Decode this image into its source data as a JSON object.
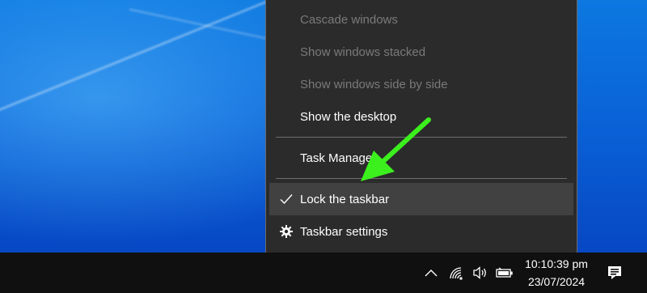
{
  "context_menu": {
    "items": [
      {
        "label": "Cascade windows",
        "enabled": false
      },
      {
        "label": "Show windows stacked",
        "enabled": false
      },
      {
        "label": "Show windows side by side",
        "enabled": false
      },
      {
        "label": "Show the desktop",
        "enabled": true
      },
      {
        "label": "Task Manager",
        "enabled": true
      },
      {
        "label": "Lock the taskbar",
        "enabled": true,
        "checked": true,
        "highlighted": true
      },
      {
        "label": "Taskbar settings",
        "enabled": true,
        "icon": "gear-icon"
      }
    ]
  },
  "taskbar": {
    "tray_icons": [
      "chevron-up-icon",
      "wifi-icon",
      "speaker-icon",
      "battery-icon"
    ],
    "clock": {
      "time": "10:10:39 pm",
      "date": "23/07/2024"
    },
    "notification_icon": "notification-icon"
  },
  "colors": {
    "menu_bg": "#2b2b2b",
    "menu_highlight": "#414141",
    "disabled_text": "#7a7a7a",
    "annotation_arrow": "#3cf01e",
    "desktop_blue": "#0a64d8"
  }
}
